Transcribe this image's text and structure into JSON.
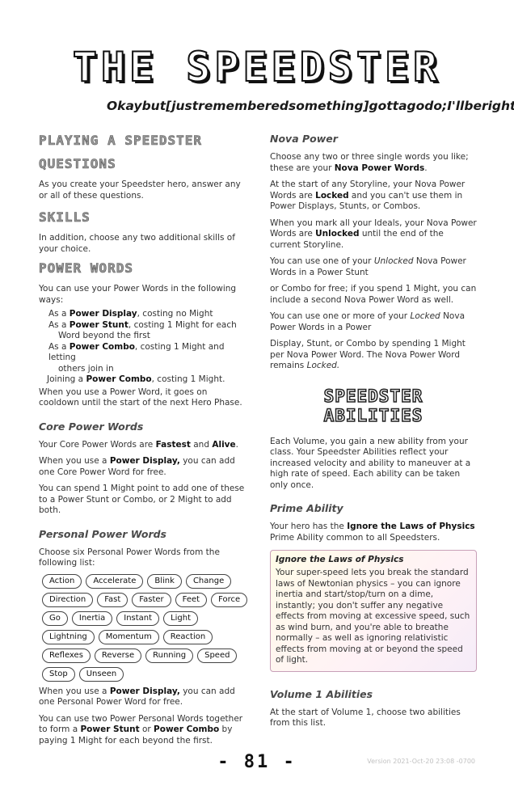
{
  "title": "THE SPEEDSTER",
  "tagline": "Okaybut[justrememberedsomething]gottagodo;I'llberightback,don'tgoanywhere",
  "left": {
    "h_playing": "PLAYING A SPEEDSTER",
    "h_questions": "QUESTIONS",
    "p_questions": "As you create your Speedster hero, answer any or all of these questions.",
    "h_skills": "SKILLS",
    "p_skills": "In addition, choose any two additional skills of your choice.",
    "h_power_words": "POWER WORDS",
    "p_power_intro": "You can use your Power Words in the following ways:",
    "uses": {
      "u1_pre": "As a ",
      "u1_b": "Power Display",
      "u1_post": ", costing no Might",
      "u2_pre": "As a ",
      "u2_b": "Power Stunt",
      "u2_post": ", costing 1 Might for each",
      "u2_cont": "Word beyond the first",
      "u3_pre": "As a ",
      "u3_b": "Power Combo",
      "u3_post": ", costing 1 Might and letting",
      "u3_cont": "others join in",
      "u4_pre": "Joining a ",
      "u4_b": "Power Combo",
      "u4_post": ", costing 1 Might."
    },
    "p_cooldown": "When you use a Power Word, it goes on cooldown until the start of the next Hero Phase.",
    "h_core": "Core Power Words",
    "p_core_pre": "Your Core Power Words are ",
    "core_1": "Fastest",
    "core_and": " and ",
    "core_2": "Alive",
    "core_end": ".",
    "p_core_display_pre": "When you use a ",
    "p_core_display_b": "Power Display,",
    "p_core_display_post": " you can add one Core Power Word for free.",
    "p_core_spend": "You can spend 1 Might point to add one of these to a Power Stunt or Combo, or 2 Might to add both.",
    "h_personal": "Personal Power Words",
    "p_personal_intro": "Choose six Personal Power Words from the following list:",
    "pills": [
      "Action",
      "Accelerate",
      "Blink",
      "Change",
      "Direction",
      "Fast",
      "Faster",
      "Feet",
      "Force",
      "Go",
      "Inertia",
      "Instant",
      "Light",
      "Lightning",
      "Momentum",
      "Reaction",
      "Reflexes",
      "Reverse",
      "Running",
      "Speed",
      "Stop",
      "Unseen"
    ],
    "p_personal_display_pre": "When you use a ",
    "p_personal_display_b": "Power Display,",
    "p_personal_display_post": " you can add one Personal Power Word for free.",
    "p_two_pre": "You can use two Power Personal Words together to form a ",
    "p_two_b1": "Power Stunt",
    "p_two_or": " or ",
    "p_two_b2": "Power Combo",
    "p_two_post": " by paying 1 Might for each beyond the first."
  },
  "right": {
    "h_nova": "Nova Power",
    "p_nova1_pre": "Choose any two or three single words you like; these are your ",
    "p_nova1_b": "Nova Power Words",
    "p_nova1_post": ".",
    "p_nova2_pre": "At the start of any Storyline, your Nova Power Words are ",
    "p_nova2_b": "Locked",
    "p_nova2_post": " and you can't use them in Power Displays, Stunts, or Combos.",
    "p_nova3_pre": "When you mark all your Ideals, your Nova Power Words are ",
    "p_nova3_b": "Unlocked",
    "p_nova3_post": " until the end of the current Storyline.",
    "p_nova4_pre": "You can use one of your ",
    "p_nova4_i": "Unlocked",
    "p_nova4_post": " Nova Power Words in a Power Stunt",
    "p_nova5": "or Combo for free; if you spend 1 Might, you can include a second Nova Power Word as well.",
    "p_nova6_pre": "You can use one or more of your ",
    "p_nova6_i": "Locked",
    "p_nova6_post": " Nova Power Words in a Power",
    "p_nova7_pre": "Display, Stunt, or Combo by spending 1 Might per Nova Power Word. The Nova Power Word remains ",
    "p_nova7_i": "Locked.",
    "h_abilities": "SPEEDSTER ABILITIES",
    "p_abilities": "Each Volume, you gain a new ability from your class. Your Speedster Abilities reflect your increased velocity and ability to maneuver at a high rate of speed. Each ability can be taken only once.",
    "h_prime": "Prime Ability",
    "p_prime_pre": "Your hero has the ",
    "p_prime_b": "Ignore the Laws of Physics",
    "p_prime_post": " Prime Ability common to all Speedsters.",
    "box_title": "Ignore the Laws of Physics",
    "box_text": "Your super-speed lets you break the standard laws of Newtonian physics – you can ignore inertia and start/stop/turn on a dime, instantly; you don't suffer any negative effects from moving at excessive speed, such as wind burn, and you're able to breathe normally – as well as ignoring relativistic effects from moving at or beyond the speed of light.",
    "h_vol1": "Volume 1 Abilities",
    "p_vol1": "At the start of Volume 1, choose two abilities from this list."
  },
  "footer": {
    "page_number": "- 81 -",
    "version": "Version 2021-Oct-20 23:08 -0700"
  }
}
